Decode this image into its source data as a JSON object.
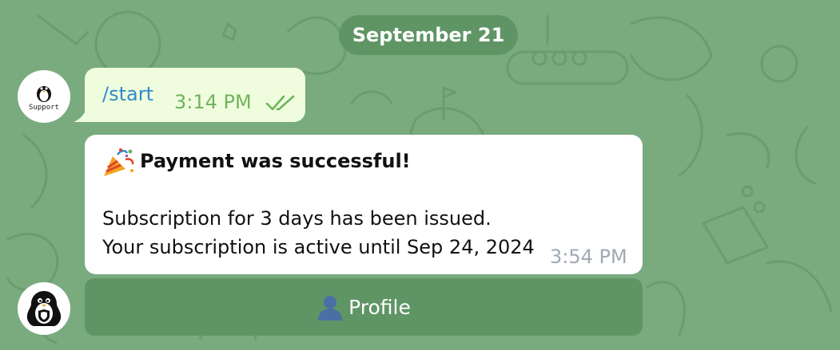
{
  "chat": {
    "date_separator": "September 21",
    "bot_avatar_label": "Support",
    "outgoing": {
      "text": "/start",
      "time": "3:14 PM",
      "status_icon": "double-check-icon"
    },
    "incoming": {
      "emoji_icon": "party-popper-icon",
      "title": "Payment was successful!",
      "line1": "Subscription for 3 days has been issued.",
      "line2": "Your subscription is active until Sep 24, 2024",
      "time": "3:54 PM"
    },
    "keyboard": {
      "profile_icon": "bust-in-silhouette-icon",
      "profile_label": "Profile"
    }
  },
  "colors": {
    "background": "#79ab7f",
    "date_pill": "#5f9565",
    "outgoing_bubble": "#effdde",
    "incoming_bubble": "#ffffff",
    "link": "#2f8bc9",
    "outgoing_time": "#6fb35b",
    "incoming_time": "#a0aab4",
    "button": "#5f9565"
  }
}
